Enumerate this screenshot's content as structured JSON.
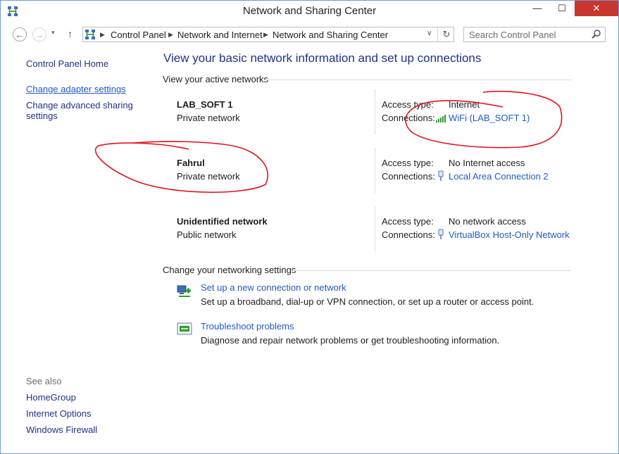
{
  "window": {
    "title": "Network and Sharing Center",
    "min": "—",
    "max": "☐",
    "close": "✕"
  },
  "nav": {
    "back": "←",
    "forward": "→",
    "up": "↑",
    "history": "▾",
    "dropdown": "∨",
    "refresh": "↻",
    "breadcrumb": [
      "Control Panel",
      "Network and Internet",
      "Network and Sharing Center"
    ],
    "search_placeholder": "Search Control Panel"
  },
  "left": {
    "home": "Control Panel Home",
    "adapter": "Change adapter settings",
    "advanced_1": "Change advanced sharing",
    "advanced_2": "settings",
    "see_also": "See also",
    "homegroup": "HomeGroup",
    "internet_options": "Internet Options",
    "firewall": "Windows Firewall"
  },
  "main": {
    "title": "View your basic network information and set up connections",
    "active_networks": "View your active networks",
    "access_type_label": "Access type:",
    "connections_label": "Connections:",
    "networks": [
      {
        "name": "LAB_SOFT 1",
        "type": "Private network",
        "access": "Internet",
        "connection": "WiFi (LAB_SOFT 1)"
      },
      {
        "name": "Fahrul",
        "type": "Private network",
        "access": "No Internet access",
        "connection": "Local Area Connection 2"
      },
      {
        "name": "Unidentified network",
        "type": "Public network",
        "access": "No network access",
        "connection": "VirtualBox Host-Only Network"
      }
    ],
    "change_settings": "Change your networking settings",
    "setup_link": "Set up a new connection or network",
    "setup_desc": "Set up a broadband, dial-up or VPN connection, or set up a router or access point.",
    "troubleshoot_link": "Troubleshoot problems",
    "troubleshoot_desc": "Diagnose and repair network problems or get troubleshooting information."
  },
  "colors": {
    "link": "#1e5ac8",
    "heading": "#1e3287",
    "annotation": "#e0141e",
    "close": "#c7372f"
  }
}
